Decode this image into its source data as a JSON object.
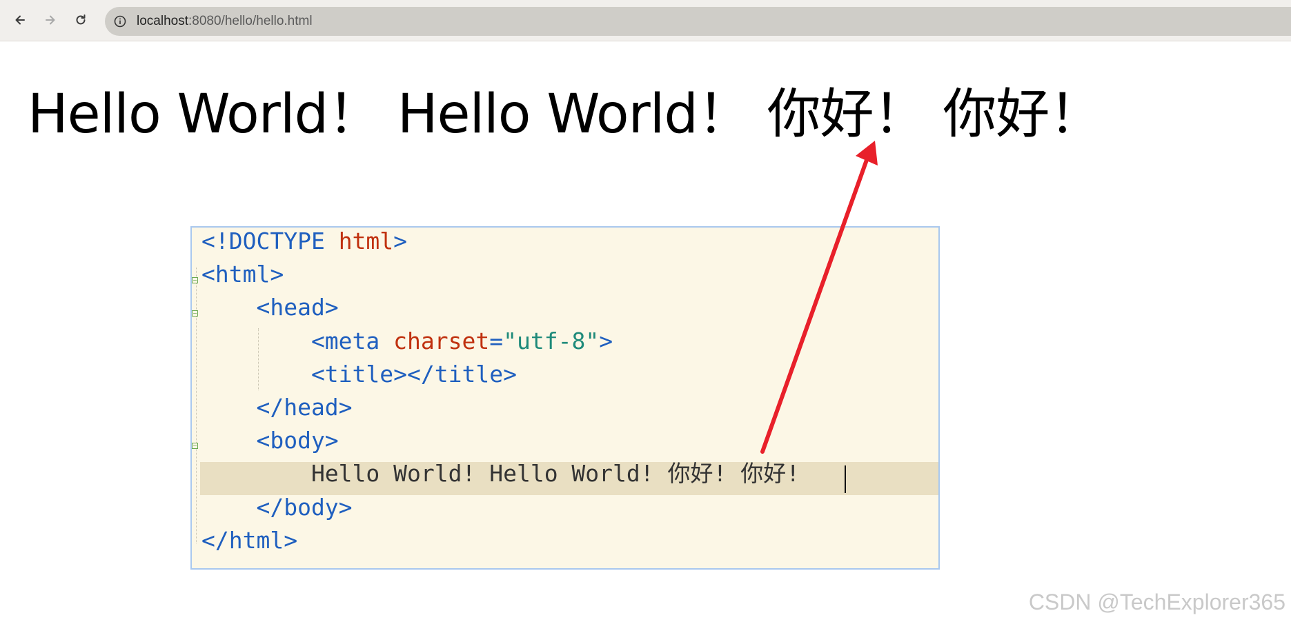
{
  "browser": {
    "url_host": "localhost",
    "url_rest": ":8080/hello/hello.html"
  },
  "page": {
    "heading": "Hello World！ Hello World！ 你好！ 你好！"
  },
  "editor": {
    "lines": [
      [
        {
          "c": "tag",
          "t": "<!DOCTYPE "
        },
        {
          "c": "kw",
          "t": "html"
        },
        {
          "c": "tag",
          "t": ">"
        }
      ],
      [
        {
          "c": "tag",
          "t": "<html>"
        }
      ],
      [
        {
          "c": "tag",
          "t": "    <head>"
        }
      ],
      [
        {
          "c": "tag",
          "t": "        <meta "
        },
        {
          "c": "kw",
          "t": "charset"
        },
        {
          "c": "tag",
          "t": "="
        },
        {
          "c": "str",
          "t": "\"utf-8\""
        },
        {
          "c": "tag",
          "t": ">"
        }
      ],
      [
        {
          "c": "tag",
          "t": "        <title></title>"
        }
      ],
      [
        {
          "c": "tag",
          "t": "    </head>"
        }
      ],
      [
        {
          "c": "tag",
          "t": "    <body>"
        }
      ],
      [
        {
          "c": "txt",
          "t": "        Hello World! Hello World! 你好! 你好!"
        }
      ],
      [
        {
          "c": "tag",
          "t": "    </body>"
        }
      ],
      [
        {
          "c": "tag",
          "t": "</html>"
        }
      ]
    ]
  },
  "watermark": "CSDN @TechExplorer365",
  "colors": {
    "arrow": "#e8202a",
    "editor_bg": "#fcf7e6",
    "current_line_bg": "#e9dfc2",
    "tag": "#1f5fbf",
    "keyword": "#c0310f",
    "string": "#1e8a7a"
  }
}
